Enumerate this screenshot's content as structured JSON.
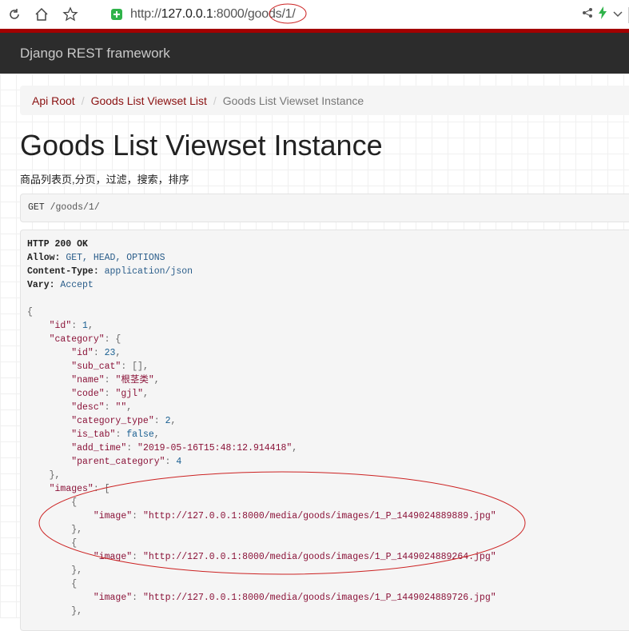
{
  "browser": {
    "url_prefix": "http://",
    "url_host": "127.0.0.1",
    "url_rest": ":8000/goods/1/",
    "icons": [
      "reload-icon",
      "home-icon",
      "star-icon",
      "shield-icon",
      "share-icon",
      "bolt-icon",
      "chevron-down-icon"
    ]
  },
  "navbar": {
    "brand": "Django REST framework"
  },
  "breadcrumb": {
    "items": [
      "Api Root",
      "Goods List Viewset List",
      "Goods List Viewset Instance"
    ],
    "separator": "/"
  },
  "page": {
    "title": "Goods List Viewset Instance",
    "description": "商品列表页,分页，过滤，搜索，排序"
  },
  "request": {
    "method": "GET",
    "path": "/goods/1/"
  },
  "response": {
    "status": "HTTP 200 OK",
    "headers": [
      {
        "name": "Allow",
        "value": "GET, HEAD, OPTIONS"
      },
      {
        "name": "Content-Type",
        "value": "application/json"
      },
      {
        "name": "Vary",
        "value": "Accept"
      }
    ],
    "body": {
      "id": 1,
      "category": {
        "id": 23,
        "sub_cat": "[]",
        "name": "根茎类",
        "code": "gjl",
        "desc": "",
        "category_type": 2,
        "is_tab": "false",
        "add_time": "2019-05-16T15:48:12.914418",
        "parent_category": 4
      },
      "images": [
        "http://127.0.0.1:8000/media/goods/images/1_P_1449024889889.jpg",
        "http://127.0.0.1:8000/media/goods/images/1_P_1449024889264.jpg",
        "http://127.0.0.1:8000/media/goods/images/1_P_1449024889726.jpg"
      ]
    }
  },
  "colors": {
    "brand_bar": "#a30000",
    "navbar_bg": "#2c2c2c",
    "link": "#8a1010",
    "annotation": "#cc2222"
  }
}
